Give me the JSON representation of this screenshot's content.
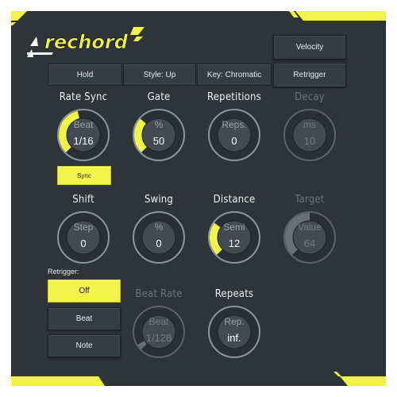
{
  "logo": "rechord",
  "accent": "#f2f34a",
  "top_buttons": {
    "velocity": "Velocity",
    "retrigger": "Retrigger"
  },
  "tabs": {
    "hold": "Hold",
    "style": "Style: Up",
    "key": "Key: Chromatic"
  },
  "knobs": {
    "rate_sync": {
      "label": "Rate Sync",
      "unit": "Beat",
      "value": "1/16",
      "level": 0.45,
      "enabled": true
    },
    "gate": {
      "label": "Gate",
      "unit": "%",
      "value": "50",
      "level": 0.32,
      "enabled": true
    },
    "repetitions": {
      "label": "Repetitions",
      "unit": "Reps.",
      "value": "0",
      "level": 0,
      "enabled": true
    },
    "decay": {
      "label": "Decay",
      "unit": "ms",
      "value": "10",
      "level": 0,
      "enabled": false
    },
    "shift": {
      "label": "Shift",
      "unit": "Step",
      "value": "0",
      "level": 0,
      "enabled": true
    },
    "swing": {
      "label": "Swing",
      "unit": "%",
      "value": "0",
      "level": 0,
      "enabled": true
    },
    "distance": {
      "label": "Distance",
      "unit": "Semi",
      "value": "12",
      "level": 0.3,
      "enabled": true
    },
    "target": {
      "label": "Target",
      "unit": "Value",
      "value": "64",
      "level": 0.5,
      "enabled": false
    },
    "beat_rate": {
      "label": "Beat Rate",
      "unit": "Beat",
      "value": "1/128",
      "level": 0.05,
      "enabled": false
    },
    "repeats": {
      "label": "Repeats",
      "unit": "Rep.",
      "value": "inf.",
      "level": 0,
      "enabled": true
    }
  },
  "sync_button": "Sync",
  "retrigger_section": {
    "title": "Retrigger:",
    "options": [
      "Off",
      "Beat",
      "Note"
    ],
    "selected": "Off"
  }
}
